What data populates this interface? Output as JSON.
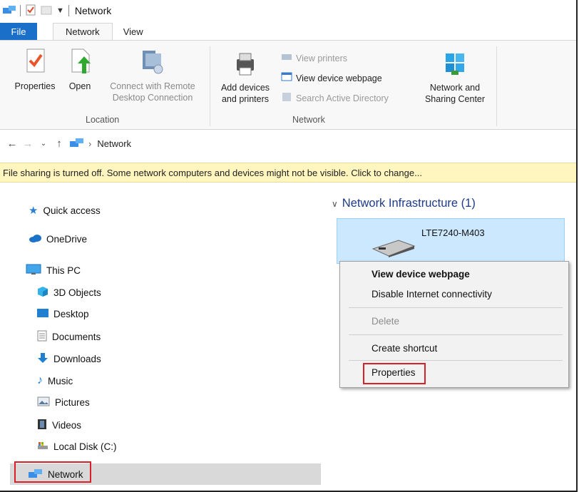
{
  "title_bar": {
    "title": "Network"
  },
  "tabs": {
    "file": "File",
    "network": "Network",
    "view": "View"
  },
  "ribbon": {
    "location": {
      "properties": "Properties",
      "open": "Open",
      "connect_line1": "Connect with Remote",
      "connect_line2": "Desktop Connection",
      "label": "Location"
    },
    "network": {
      "add_line1": "Add devices",
      "add_line2": "and printers",
      "view_printers": "View printers",
      "view_webpage": "View device webpage",
      "search_ad": "Search Active Directory",
      "nsc_line1": "Network and",
      "nsc_line2": "Sharing Center",
      "label": "Network"
    }
  },
  "address": {
    "crumb": "Network"
  },
  "infobar": {
    "text": "File sharing is turned off. Some network computers and devices might not be visible. Click to change..."
  },
  "nav": {
    "quick_access": "Quick access",
    "onedrive": "OneDrive",
    "this_pc": "This PC",
    "objects3d": "3D Objects",
    "desktop": "Desktop",
    "documents": "Documents",
    "downloads": "Downloads",
    "music": "Music",
    "pictures": "Pictures",
    "videos": "Videos",
    "local_disk": "Local Disk (C:)",
    "network": "Network"
  },
  "content": {
    "group_header": "Network Infrastructure (1)",
    "device_name": "LTE7240-M403"
  },
  "context_menu": {
    "view_webpage": "View device webpage",
    "disable_internet": "Disable Internet connectivity",
    "delete": "Delete",
    "create_shortcut": "Create shortcut",
    "properties": "Properties"
  },
  "colors": {
    "accent": "#1a6fc9",
    "highlight_box": "#d9202a",
    "selection": "#cce8ff",
    "infobar": "#fff5bf"
  }
}
